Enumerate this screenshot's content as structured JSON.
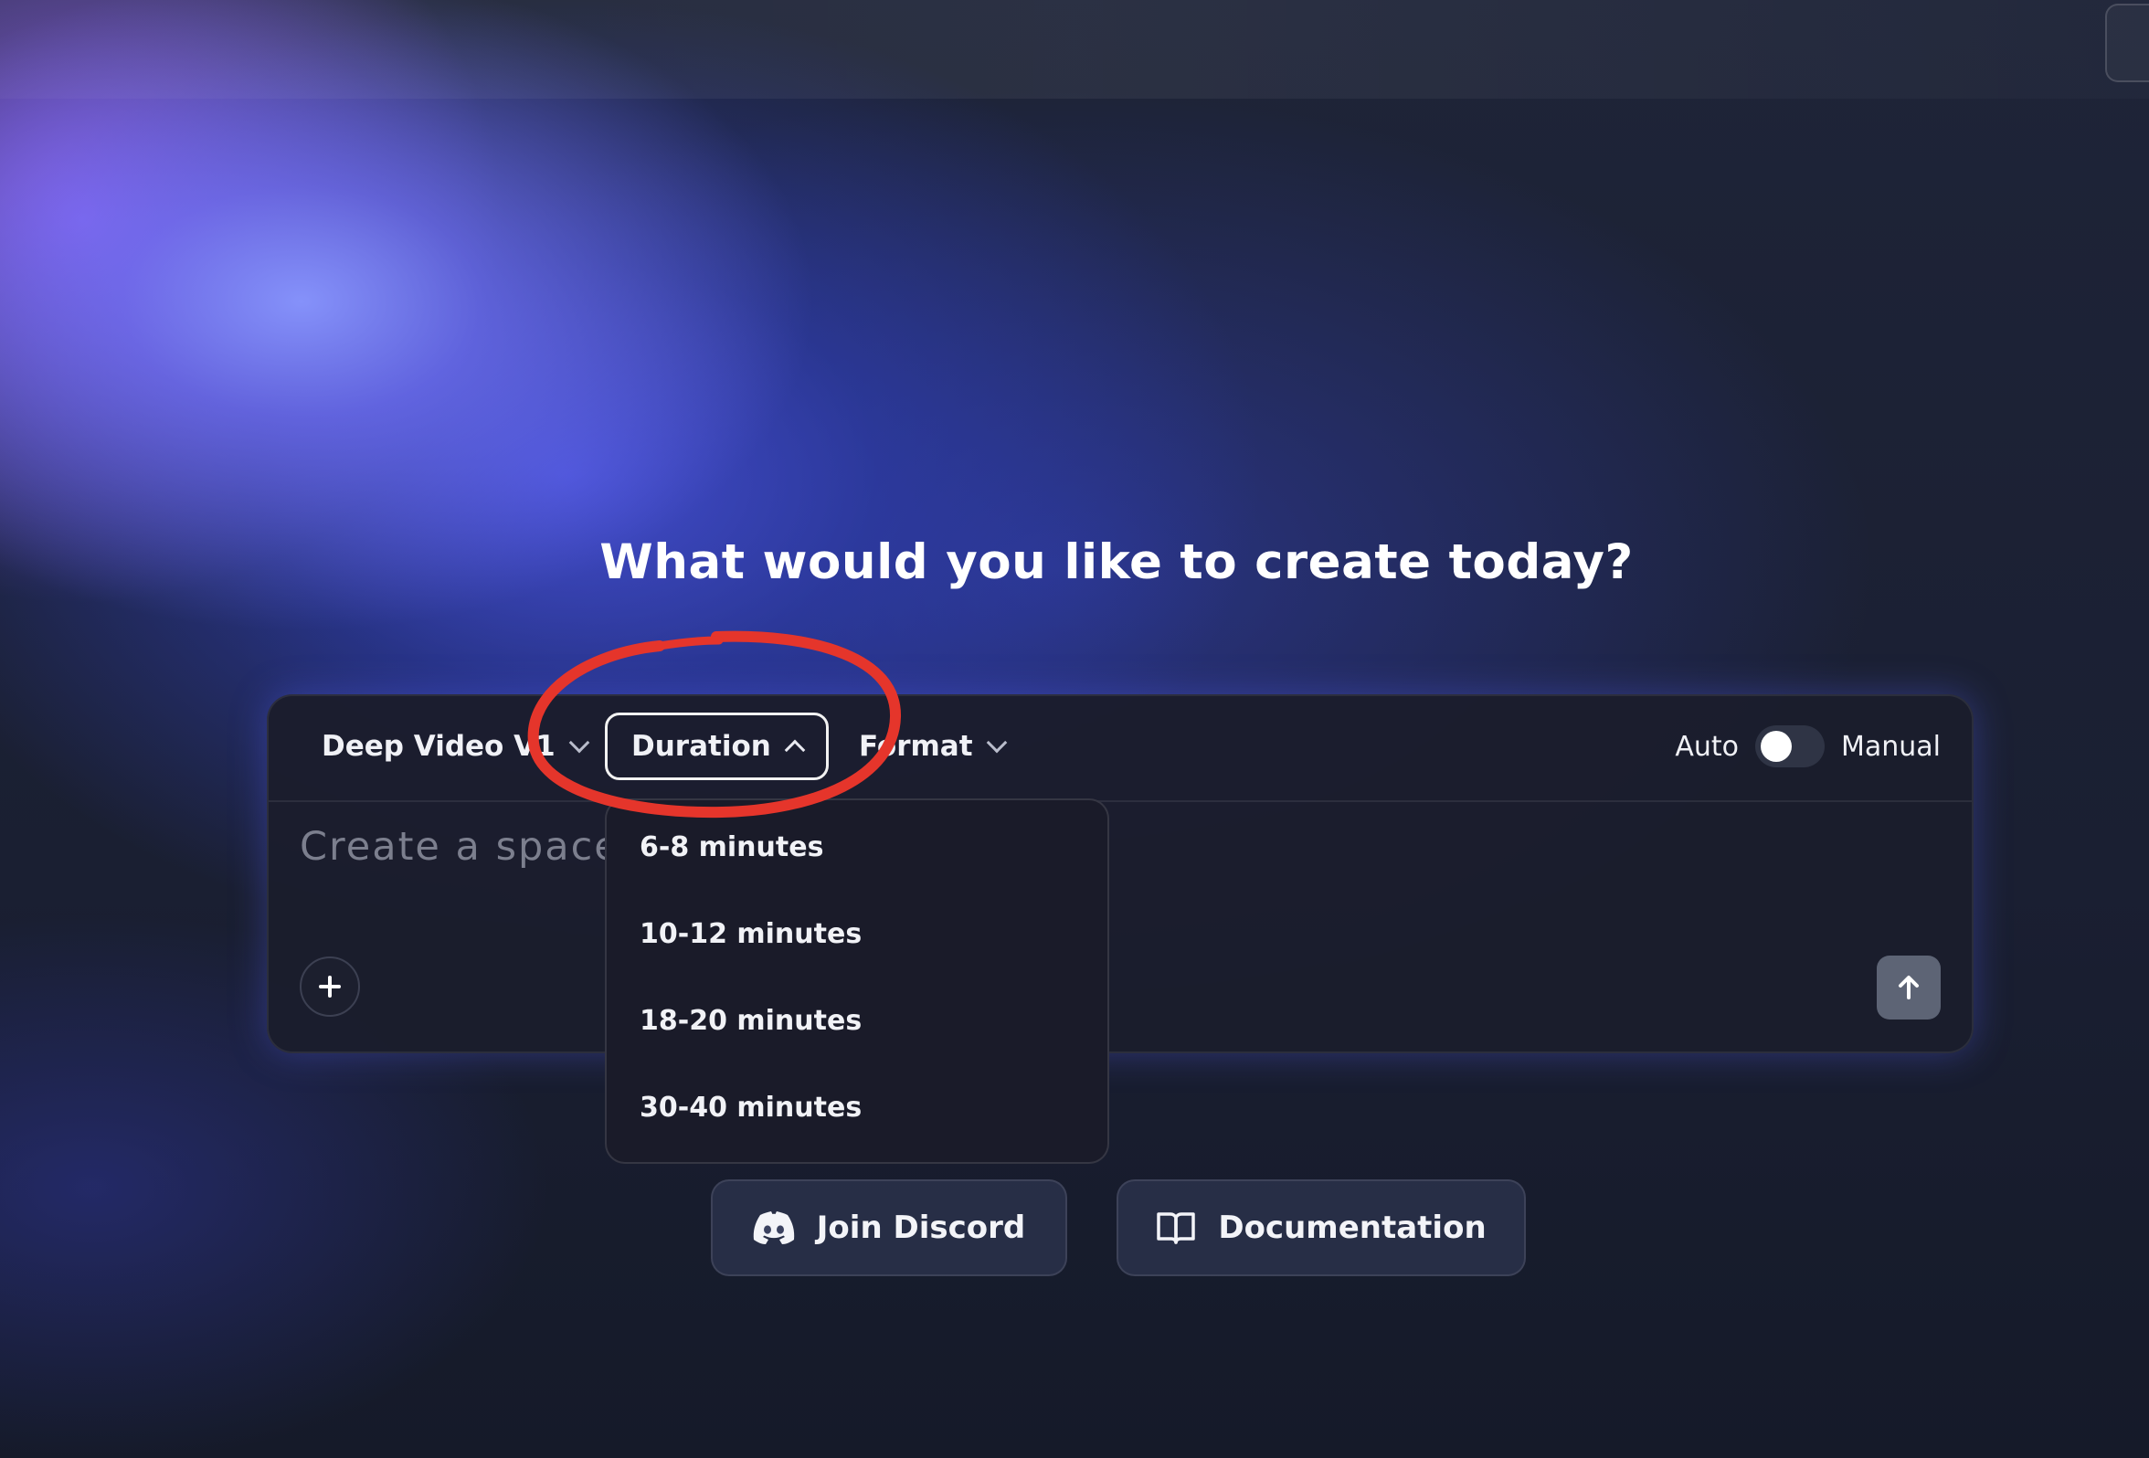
{
  "headline": "What would you like to create today?",
  "toolbar": {
    "model_label": "Deep Video V1",
    "duration_label": "Duration",
    "format_label": "Format",
    "mode_left": "Auto",
    "mode_right": "Manual"
  },
  "prompt": {
    "placeholder": "Create a space"
  },
  "duration_menu": {
    "options": [
      "6-8 minutes",
      "10-12 minutes",
      "18-20 minutes",
      "30-40 minutes"
    ]
  },
  "links": {
    "discord_label": "Join Discord",
    "docs_label": "Documentation"
  },
  "icons": {
    "plus": "plus-icon",
    "send": "arrow-up-icon",
    "discord": "discord-icon",
    "docs": "book-icon"
  },
  "colors": {
    "annotation": "#e5352b",
    "accent_glow": "#7b86ff"
  }
}
